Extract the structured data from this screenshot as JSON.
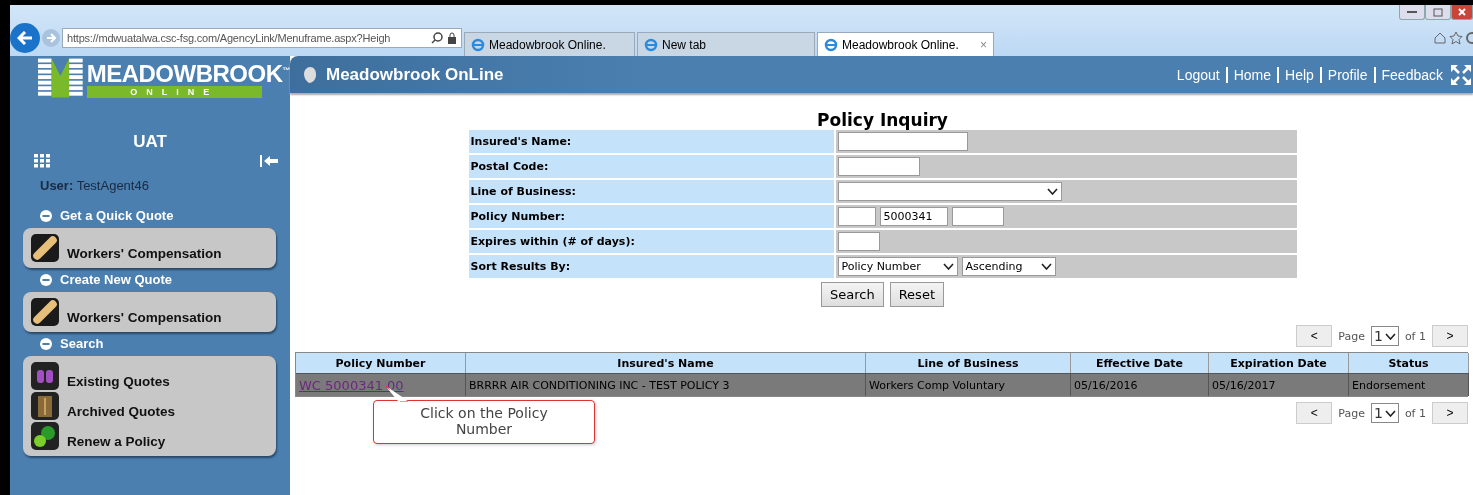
{
  "browser": {
    "address": "https://mdwuatalwa.csc-fsg.com/AgencyLink/Menuframe.aspx?Heigh",
    "tabs": [
      {
        "title": "Meadowbrook Online.",
        "selected": false
      },
      {
        "title": "New tab",
        "selected": false
      },
      {
        "title": "Meadowbrook Online.",
        "selected": true,
        "close": "×"
      }
    ]
  },
  "sidebar": {
    "logo": {
      "name": "MEADOWBROOK",
      "mark": "™",
      "sub": "ONLINE"
    },
    "env": "UAT",
    "user_label": "User:",
    "user": "TestAgent46",
    "sections": [
      {
        "title": "Get a Quick Quote",
        "expanded": true,
        "items": [
          {
            "label": "Workers' Compensation"
          }
        ]
      },
      {
        "title": "Create New Quote",
        "expanded": true,
        "items": [
          {
            "label": "Workers' Compensation"
          }
        ]
      },
      {
        "title": "Search",
        "expanded": true,
        "items": [
          {
            "label": "Existing Quotes"
          },
          {
            "label": "Archived Quotes"
          },
          {
            "label": "Renew a Policy"
          }
        ]
      }
    ]
  },
  "header": {
    "title": "Meadowbrook OnLine",
    "links": [
      "Logout",
      "Home",
      "Help",
      "Profile",
      "Feedback"
    ]
  },
  "form": {
    "title": "Policy Inquiry",
    "rows": [
      {
        "label": "Insured's Name:",
        "kind": "text"
      },
      {
        "label": "Postal Code:",
        "kind": "short"
      },
      {
        "label": "Line of Business:",
        "kind": "select"
      },
      {
        "label": "Policy Number:",
        "kind": "policy",
        "value": "5000341"
      },
      {
        "label": "Expires within (# of days):",
        "kind": "tiny"
      },
      {
        "label": "Sort Results By:",
        "kind": "sort",
        "sort_field": "Policy Number",
        "sort_order": "Ascending"
      }
    ],
    "buttons": [
      "Search",
      "Reset"
    ]
  },
  "pagers": [
    {
      "prev": "<",
      "label": "Page",
      "page": "1",
      "of": "of 1",
      "next": ">"
    },
    {
      "prev": "<",
      "label": "Page",
      "page": "1",
      "of": "of 1",
      "next": ">"
    }
  ],
  "table": {
    "columns": [
      "Policy Number",
      "Insured's Name",
      "Line of Business",
      "Effective Date",
      "Expiration Date",
      "Status"
    ],
    "rows": [
      {
        "selected": true,
        "cells": [
          "WC 5000341 00",
          "BRRRR AIR CONDITIONING INC - TEST POLICY 3",
          "Workers Comp Voluntary",
          "05/16/2016",
          "05/16/2017",
          "Endorsement"
        ]
      }
    ]
  },
  "callout": "Click on the Policy Number"
}
